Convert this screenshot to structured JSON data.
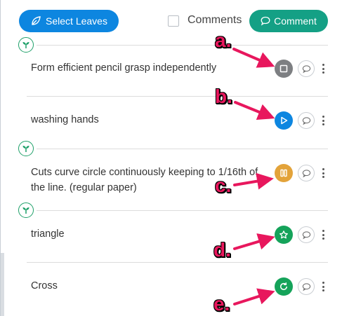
{
  "toolbar": {
    "select_leaves_label": "Select Leaves",
    "comments_checkbox_label": "Comments",
    "comment_button_label": "Comment"
  },
  "rows": [
    {
      "text": "Form efficient pencil grasp independently",
      "status": "stop",
      "status_color": "#7d7f82",
      "annotation": "a."
    },
    {
      "text": "washing hands",
      "status": "play",
      "status_color": "#0d86e0",
      "annotation": "b."
    },
    {
      "text_line1": "Cuts curve circle continuously keeping to 1/16th of",
      "text_line2": "the line. (regular paper)",
      "status": "pause",
      "status_color": "#e3a33a",
      "annotation": "c."
    },
    {
      "text": "triangle",
      "status": "star",
      "status_color": "#15a35a",
      "annotation": "d."
    },
    {
      "text": "Cross",
      "status": "redo",
      "status_color": "#15a35a",
      "annotation": "e."
    }
  ],
  "colors": {
    "primary_blue": "#0d86e0",
    "teal": "#14a085",
    "sprout_green": "#1ea069",
    "annotation_pink": "#e8175d"
  },
  "icons": [
    "leaf-icon",
    "speech-bubble-icon",
    "sprout-icon",
    "stop-icon",
    "play-icon",
    "pause-icon",
    "star-icon",
    "redo-icon",
    "kebab-icon"
  ]
}
